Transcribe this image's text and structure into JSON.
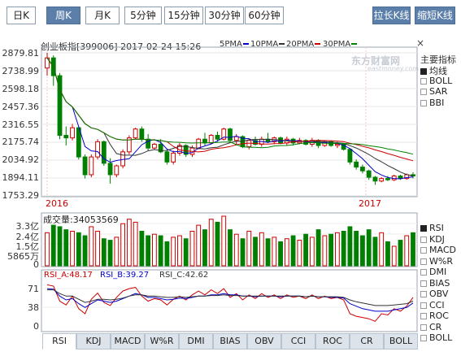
{
  "period_tabs": [
    {
      "label": "日K",
      "active": false
    },
    {
      "label": "周K",
      "active": true
    },
    {
      "label": "月K",
      "active": false
    },
    {
      "label": "5分钟",
      "active": false
    },
    {
      "label": "15分钟",
      "active": false
    },
    {
      "label": "30分钟",
      "active": false
    },
    {
      "label": "60分钟",
      "active": false
    }
  ],
  "buttons": {
    "stretch": "拉长K线",
    "shrink": "缩短K线"
  },
  "header": {
    "title": "创业板指[399006] 2017-02-24 15:26",
    "ma": [
      {
        "label": "5PMA",
        "color": "#0000cc"
      },
      {
        "label": "10PMA",
        "color": "#333333"
      },
      {
        "label": "20PMA",
        "color": "#cc0000"
      },
      {
        "label": "30PMA",
        "color": "#008000"
      }
    ],
    "close_glyph": "×"
  },
  "watermark": {
    "main": "东方财富网",
    "sub": "eastmoney.com"
  },
  "indicator_panel": {
    "title": "主要指标",
    "items": [
      {
        "label": "均线",
        "checked": true
      },
      {
        "label": "BOLL",
        "checked": false
      },
      {
        "label": "SAR",
        "checked": false
      },
      {
        "label": "BBI",
        "checked": false
      }
    ]
  },
  "price_axis": [
    "2879.81",
    "2738.99",
    "2598.18",
    "2457.36",
    "2316.55",
    "2175.74",
    "2034.92",
    "1894.11",
    "1753.29"
  ],
  "year_labels": [
    "2016",
    "2017"
  ],
  "volume": {
    "title": "成交量:34053569",
    "axis": [
      "3.3亿",
      "2.4亿",
      "1.5亿",
      "5865万",
      "0"
    ]
  },
  "sub_indicator_panel": {
    "items": [
      {
        "label": "RSI",
        "checked": true
      },
      {
        "label": "KDJ",
        "checked": false
      },
      {
        "label": "MACD",
        "checked": false
      },
      {
        "label": "W%R",
        "checked": false
      },
      {
        "label": "DMI",
        "checked": false
      },
      {
        "label": "BIAS",
        "checked": false
      },
      {
        "label": "OBV",
        "checked": false
      },
      {
        "label": "CCI",
        "checked": false
      },
      {
        "label": "ROC",
        "checked": false
      },
      {
        "label": "CR",
        "checked": false
      },
      {
        "label": "BOLL",
        "checked": false
      }
    ]
  },
  "rsi": {
    "labels": [
      {
        "text": "RSI_A:48.17",
        "color": "#cc0000"
      },
      {
        "text": "RSI_B:39.27",
        "color": "#0000cc"
      },
      {
        "text": "RSI_C:42.62",
        "color": "#333333"
      }
    ],
    "axis": [
      "71",
      "38",
      "0"
    ]
  },
  "bottom_tabs": [
    {
      "label": "RSI",
      "active": true
    },
    {
      "label": "KDJ",
      "active": false
    },
    {
      "label": "MACD",
      "active": false
    },
    {
      "label": "W%R",
      "active": false
    },
    {
      "label": "DMI",
      "active": false
    },
    {
      "label": "BIAS",
      "active": false
    },
    {
      "label": "OBV",
      "active": false
    },
    {
      "label": "CCI",
      "active": false
    },
    {
      "label": "ROC",
      "active": false
    },
    {
      "label": "CR",
      "active": false
    },
    {
      "label": "BOLL",
      "active": false
    }
  ],
  "chart_data": {
    "type": "candlestick",
    "title": "创业板指[399006] 2017-02-24 15:26",
    "ylim": [
      1753.29,
      2879.81
    ],
    "x_labels": [
      "2016",
      "2017"
    ],
    "up_color": "#cc0000",
    "down_color": "#008000",
    "candles": [
      {
        "o": 2760,
        "h": 2880,
        "l": 2700,
        "c": 2840
      },
      {
        "o": 2840,
        "h": 2860,
        "l": 2620,
        "c": 2700
      },
      {
        "o": 2700,
        "h": 2720,
        "l": 2200,
        "c": 2230
      },
      {
        "o": 2230,
        "h": 2300,
        "l": 2150,
        "c": 2210
      },
      {
        "o": 2210,
        "h": 2320,
        "l": 2190,
        "c": 2290
      },
      {
        "o": 2290,
        "h": 2300,
        "l": 2040,
        "c": 2060
      },
      {
        "o": 2060,
        "h": 2080,
        "l": 1890,
        "c": 1920
      },
      {
        "o": 1920,
        "h": 2080,
        "l": 1900,
        "c": 2060
      },
      {
        "o": 2060,
        "h": 2200,
        "l": 2040,
        "c": 2180
      },
      {
        "o": 2180,
        "h": 2190,
        "l": 1990,
        "c": 2010
      },
      {
        "o": 2010,
        "h": 2050,
        "l": 1850,
        "c": 1920
      },
      {
        "o": 1920,
        "h": 2000,
        "l": 1900,
        "c": 1990
      },
      {
        "o": 1990,
        "h": 2120,
        "l": 1970,
        "c": 2100
      },
      {
        "o": 2100,
        "h": 2230,
        "l": 2080,
        "c": 2210
      },
      {
        "o": 2210,
        "h": 2290,
        "l": 2200,
        "c": 2280
      },
      {
        "o": 2280,
        "h": 2300,
        "l": 2180,
        "c": 2200
      },
      {
        "o": 2200,
        "h": 2240,
        "l": 2110,
        "c": 2130
      },
      {
        "o": 2130,
        "h": 2170,
        "l": 2120,
        "c": 2160
      },
      {
        "o": 2160,
        "h": 2200,
        "l": 2090,
        "c": 2100
      },
      {
        "o": 2100,
        "h": 2120,
        "l": 2000,
        "c": 2020
      },
      {
        "o": 2020,
        "h": 2110,
        "l": 2000,
        "c": 2090
      },
      {
        "o": 2090,
        "h": 2170,
        "l": 2070,
        "c": 2150
      },
      {
        "o": 2150,
        "h": 2160,
        "l": 2060,
        "c": 2080
      },
      {
        "o": 2080,
        "h": 2150,
        "l": 2060,
        "c": 2130
      },
      {
        "o": 2130,
        "h": 2210,
        "l": 2120,
        "c": 2200
      },
      {
        "o": 2200,
        "h": 2250,
        "l": 2150,
        "c": 2170
      },
      {
        "o": 2170,
        "h": 2240,
        "l": 2160,
        "c": 2230
      },
      {
        "o": 2230,
        "h": 2260,
        "l": 2180,
        "c": 2200
      },
      {
        "o": 2200,
        "h": 2290,
        "l": 2190,
        "c": 2280
      },
      {
        "o": 2280,
        "h": 2290,
        "l": 2170,
        "c": 2190
      },
      {
        "o": 2190,
        "h": 2240,
        "l": 2150,
        "c": 2220
      },
      {
        "o": 2220,
        "h": 2230,
        "l": 2130,
        "c": 2140
      },
      {
        "o": 2140,
        "h": 2200,
        "l": 2120,
        "c": 2190
      },
      {
        "o": 2190,
        "h": 2220,
        "l": 2150,
        "c": 2160
      },
      {
        "o": 2160,
        "h": 2220,
        "l": 2140,
        "c": 2200
      },
      {
        "o": 2200,
        "h": 2250,
        "l": 2170,
        "c": 2180
      },
      {
        "o": 2180,
        "h": 2220,
        "l": 2160,
        "c": 2210
      },
      {
        "o": 2210,
        "h": 2220,
        "l": 2160,
        "c": 2170
      },
      {
        "o": 2170,
        "h": 2220,
        "l": 2150,
        "c": 2200
      },
      {
        "o": 2200,
        "h": 2210,
        "l": 2150,
        "c": 2170
      },
      {
        "o": 2170,
        "h": 2210,
        "l": 2160,
        "c": 2190
      },
      {
        "o": 2190,
        "h": 2200,
        "l": 2150,
        "c": 2160
      },
      {
        "o": 2160,
        "h": 2210,
        "l": 2140,
        "c": 2190
      },
      {
        "o": 2190,
        "h": 2200,
        "l": 2130,
        "c": 2150
      },
      {
        "o": 2150,
        "h": 2190,
        "l": 2140,
        "c": 2180
      },
      {
        "o": 2180,
        "h": 2190,
        "l": 2140,
        "c": 2150
      },
      {
        "o": 2150,
        "h": 2180,
        "l": 2130,
        "c": 2160
      },
      {
        "o": 2160,
        "h": 2170,
        "l": 2110,
        "c": 2120
      },
      {
        "o": 2120,
        "h": 2130,
        "l": 2000,
        "c": 2020
      },
      {
        "o": 2020,
        "h": 2040,
        "l": 1960,
        "c": 1980
      },
      {
        "o": 1980,
        "h": 2000,
        "l": 1930,
        "c": 1950
      },
      {
        "o": 1950,
        "h": 1960,
        "l": 1880,
        "c": 1900
      },
      {
        "o": 1900,
        "h": 1910,
        "l": 1840,
        "c": 1870
      },
      {
        "o": 1870,
        "h": 1900,
        "l": 1860,
        "c": 1890
      },
      {
        "o": 1890,
        "h": 1910,
        "l": 1870,
        "c": 1880
      },
      {
        "o": 1880,
        "h": 1920,
        "l": 1870,
        "c": 1910
      },
      {
        "o": 1910,
        "h": 1920,
        "l": 1880,
        "c": 1890
      },
      {
        "o": 1890,
        "h": 1930,
        "l": 1880,
        "c": 1920
      },
      {
        "o": 1920,
        "h": 1940,
        "l": 1890,
        "c": 1910
      }
    ],
    "volumes": [
      2.2,
      2.7,
      2.6,
      2.4,
      2.3,
      2.2,
      2.0,
      2.6,
      2.3,
      1.8,
      1.7,
      1.9,
      2.8,
      3.1,
      2.9,
      2.3,
      2.0,
      2.1,
      2.0,
      1.6,
      1.9,
      2.0,
      1.8,
      2.3,
      2.7,
      2.4,
      3.1,
      2.9,
      3.3,
      2.4,
      2.1,
      1.8,
      2.3,
      1.9,
      2.2,
      1.8,
      1.9,
      1.6,
      1.8,
      2.0,
      1.7,
      2.1,
      1.9,
      2.4,
      2.0,
      2.1,
      2.2,
      2.3,
      2.6,
      2.3,
      2.0,
      2.4,
      1.9,
      2.2,
      1.6,
      1.3,
      1.7,
      2.0,
      2.2
    ],
    "rsi_a": [
      68,
      66,
      42,
      36,
      50,
      30,
      22,
      45,
      55,
      40,
      35,
      48,
      58,
      62,
      64,
      50,
      42,
      46,
      44,
      36,
      45,
      50,
      44,
      52,
      58,
      52,
      60,
      54,
      62,
      48,
      54,
      44,
      52,
      46,
      54,
      48,
      52,
      46,
      52,
      48,
      50,
      46,
      52,
      46,
      50,
      46,
      48,
      44,
      22,
      18,
      16,
      14,
      10,
      22,
      20,
      30,
      26,
      34,
      48
    ],
    "rsi_b": [
      62,
      61,
      50,
      44,
      46,
      38,
      32,
      38,
      44,
      42,
      40,
      42,
      46,
      50,
      54,
      52,
      48,
      48,
      46,
      44,
      45,
      47,
      46,
      48,
      50,
      50,
      52,
      52,
      54,
      52,
      52,
      50,
      50,
      49,
      50,
      50,
      50,
      49,
      50,
      50,
      50,
      49,
      50,
      49,
      49,
      48,
      48,
      47,
      38,
      34,
      30,
      28,
      26,
      26,
      26,
      28,
      30,
      32,
      39
    ],
    "rsi_c": [
      60,
      60,
      54,
      50,
      50,
      45,
      40,
      42,
      45,
      45,
      44,
      45,
      47,
      50,
      52,
      52,
      50,
      50,
      49,
      48,
      48,
      49,
      48,
      49,
      50,
      50,
      51,
      51,
      52,
      51,
      51,
      50,
      50,
      50,
      50,
      50,
      50,
      50,
      50,
      50,
      50,
      49,
      50,
      49,
      49,
      49,
      49,
      48,
      44,
      41,
      39,
      37,
      35,
      35,
      35,
      36,
      37,
      38,
      42
    ]
  }
}
